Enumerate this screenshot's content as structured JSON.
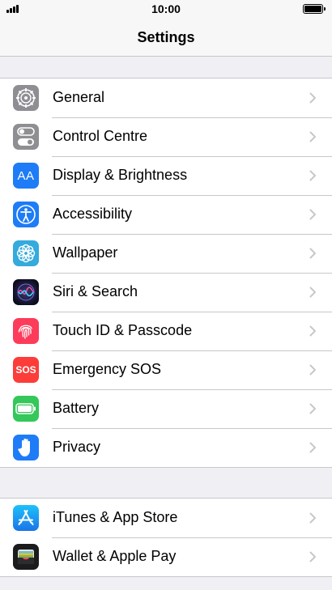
{
  "status": {
    "time": "10:00"
  },
  "nav": {
    "title": "Settings"
  },
  "groups": [
    {
      "items": [
        {
          "label": "General",
          "icon": "gear-icon",
          "color": "#8e8e93"
        },
        {
          "label": "Control Centre",
          "icon": "toggles-icon",
          "color": "#8e8e93"
        },
        {
          "label": "Display & Brightness",
          "icon": "text-size-icon",
          "color": "#1e7cf7",
          "glyph": "AA"
        },
        {
          "label": "Accessibility",
          "icon": "accessibility-icon",
          "color": "#1e7cf7"
        },
        {
          "label": "Wallpaper",
          "icon": "flower-icon",
          "color": "#35aadc"
        },
        {
          "label": "Siri & Search",
          "icon": "siri-icon",
          "color": "#1c1c3c"
        },
        {
          "label": "Touch ID & Passcode",
          "icon": "fingerprint-icon",
          "color": "#fd3b5a"
        },
        {
          "label": "Emergency SOS",
          "icon": "sos-icon",
          "color": "#fc3d39",
          "glyph": "SOS"
        },
        {
          "label": "Battery",
          "icon": "battery-icon",
          "color": "#34c759"
        },
        {
          "label": "Privacy",
          "icon": "hand-icon",
          "color": "#1e7cf7"
        }
      ]
    },
    {
      "items": [
        {
          "label": "iTunes & App Store",
          "icon": "app-store-icon",
          "color": "#1e9bf5"
        },
        {
          "label": "Wallet & Apple Pay",
          "icon": "wallet-icon",
          "color": "#1c1c1e"
        }
      ]
    }
  ]
}
